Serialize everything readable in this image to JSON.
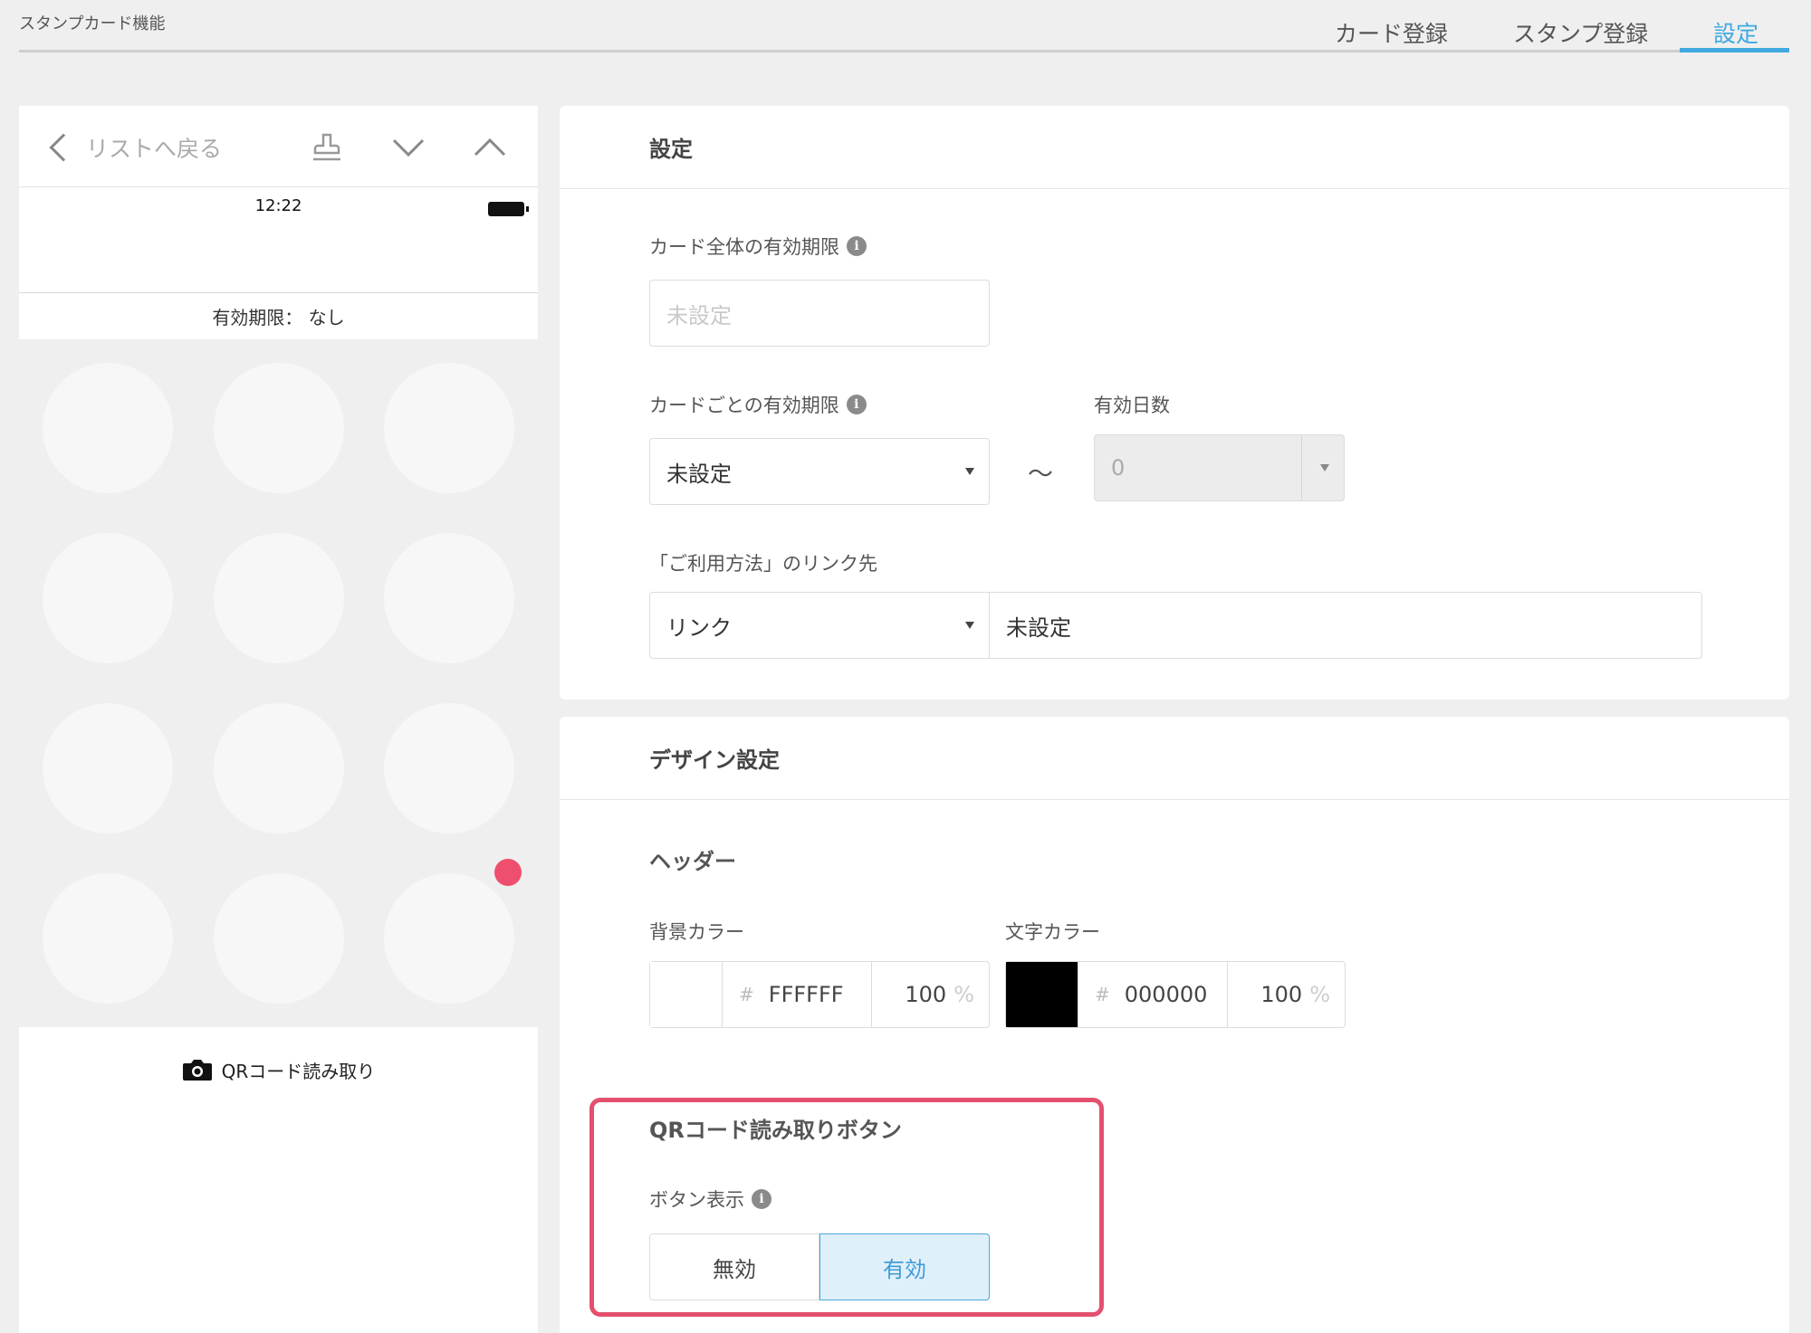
{
  "app": {
    "title": "スタンプカード機能"
  },
  "tabs": [
    {
      "label": "カード登録",
      "active": false
    },
    {
      "label": "スタンプ登録",
      "active": false
    },
    {
      "label": "設定",
      "active": true
    }
  ],
  "preview": {
    "back_label": "リストへ戻る",
    "icons": [
      "stamp-icon",
      "chevron-down-icon",
      "chevron-up-icon"
    ],
    "status_time": "12:22",
    "expiry_text": "有効期限： なし",
    "stamp_count": 12,
    "qr_button_label": "QRコード読み取り"
  },
  "settings": {
    "title": "設定",
    "card_expiry": {
      "label": "カード全体の有効期限",
      "placeholder": "未設定"
    },
    "per_card_expiry": {
      "label": "カードごとの有効期限",
      "value": "未設定"
    },
    "valid_days": {
      "label": "有効日数",
      "value": "0"
    },
    "range_separator": "〜",
    "usage_link": {
      "label": "「ご利用方法」のリンク先",
      "type_value": "リンク",
      "target_value": "未設定"
    }
  },
  "design": {
    "title": "デザイン設定",
    "header_section": "ヘッダー",
    "bg_color": {
      "label": "背景カラー",
      "hash": "#",
      "hex": "FFFFFF",
      "opacity": "100",
      "unit": "%",
      "swatch": "#FFFFFF"
    },
    "text_color": {
      "label": "文字カラー",
      "hash": "#",
      "hex": "000000",
      "opacity": "100",
      "unit": "%",
      "swatch": "#000000"
    },
    "qr_section": {
      "title": "QRコード読み取りボタン",
      "display_label": "ボタン表示",
      "options": [
        "無効",
        "有効"
      ],
      "selected": "有効"
    }
  },
  "colors": {
    "accent": "#3fa9e0",
    "highlight": "#e4506e",
    "dot": "#ef4f6e"
  }
}
